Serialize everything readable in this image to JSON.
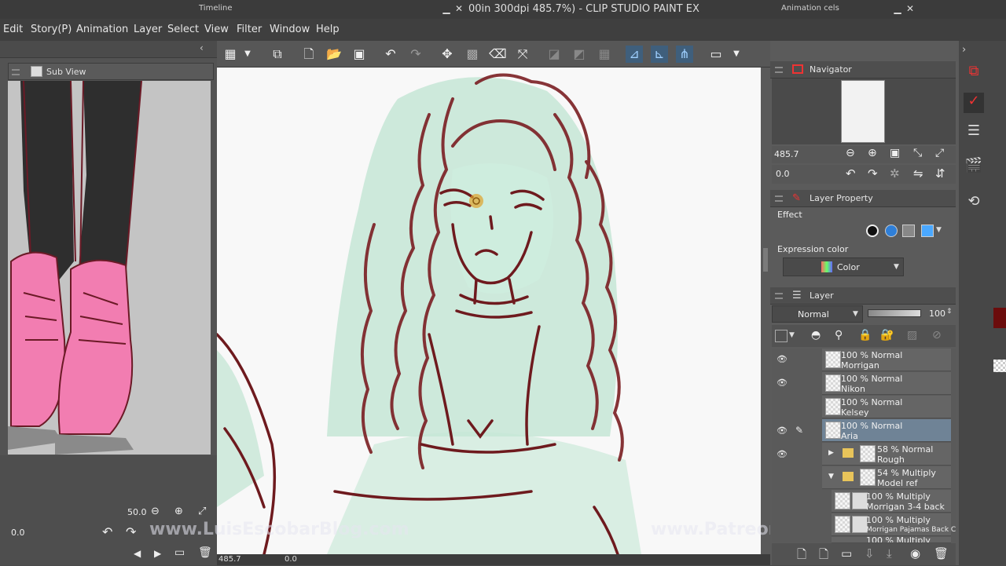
{
  "titlebar": {
    "left_title": "Timeline",
    "main_title": "00in 300dpi 485.7%)  - CLIP STUDIO PAINT EX",
    "right_title": "Animation cels"
  },
  "menu": [
    "Edit",
    "Story(P)",
    "Animation",
    "Layer",
    "Select",
    "View",
    "Filter",
    "Window",
    "Help"
  ],
  "subview": {
    "title": "Sub View",
    "zoom": "50.0",
    "angle": "0.0"
  },
  "navigator": {
    "title": "Navigator",
    "zoom": "485.7",
    "angle": "0.0"
  },
  "layer_property": {
    "title": "Layer Property",
    "effect_label": "Effect",
    "expression_label": "Expression color",
    "expression_value": "Color"
  },
  "layer_panel": {
    "title": "Layer",
    "blend_mode": "Normal",
    "opacity": "100",
    "layers": [
      {
        "pct": "100 %",
        "mode": "Normal",
        "name": "Morrigan"
      },
      {
        "pct": "100 %",
        "mode": "Normal",
        "name": "Nikon"
      },
      {
        "pct": "100 %",
        "mode": "Normal",
        "name": "Kelsey"
      },
      {
        "pct": "100 %",
        "mode": "Normal",
        "name": "Aria"
      },
      {
        "pct": "58 %",
        "mode": "Normal",
        "name": "Rough"
      },
      {
        "pct": "54 %",
        "mode": "Multiply",
        "name": "Model ref"
      },
      {
        "pct": "100 %",
        "mode": "Multiply",
        "name": "Morrigan 3-4 back"
      },
      {
        "pct": "100 %",
        "mode": "Multiply",
        "name": "Morrigan Pajamas Back C"
      },
      {
        "pct": "100 %",
        "mode": "Multiply",
        "name": ""
      }
    ]
  },
  "status": {
    "zoom": "485.7",
    "angle": "0.0"
  },
  "watermarks": {
    "left": "www.LuisEscobarBlog.com",
    "right": "www.Patreon.com/LuisEscobar"
  },
  "colors": {
    "line_red": "#7a1e22",
    "green_sketch": "#8fd1b0",
    "pink_boots": "#f07ab0",
    "selected_layer": "#6f8396"
  }
}
